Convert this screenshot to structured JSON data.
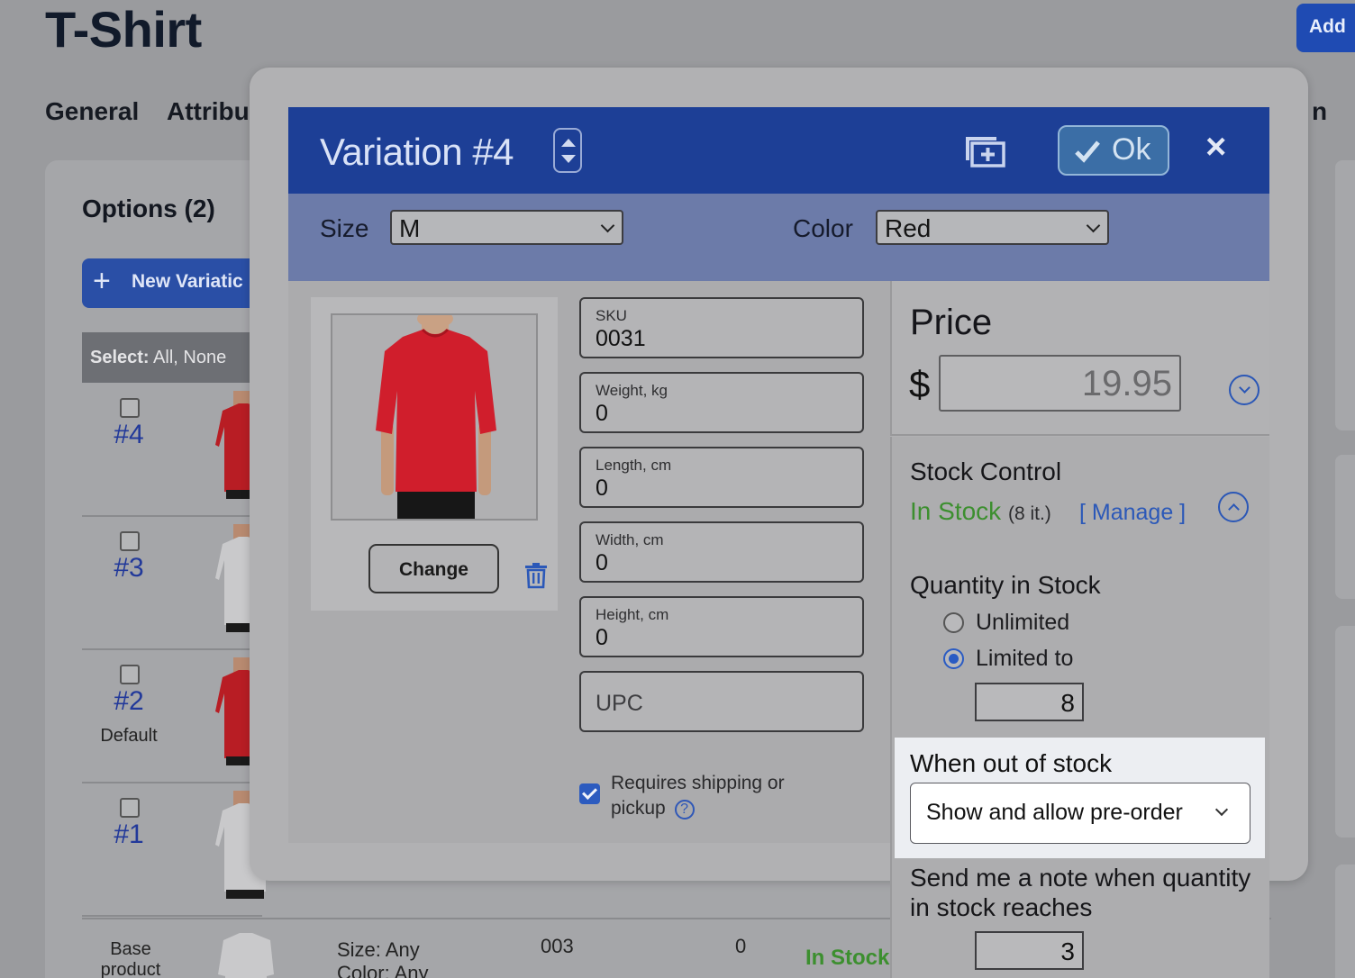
{
  "page": {
    "title": "T-Shirt",
    "add_button": "Add",
    "tabs": [
      "General",
      "Attribu",
      "n"
    ]
  },
  "options": {
    "title": "Options (2)",
    "new_variation": "New Variatic",
    "select_label": "Select:",
    "select_links": "All, None",
    "rows": [
      {
        "num": "#4",
        "sub": "",
        "shirt_color": "#b81d24"
      },
      {
        "num": "#3",
        "sub": "",
        "shirt_color": "#c9c9cb"
      },
      {
        "num": "#2",
        "sub": "Default",
        "shirt_color": "#b81d24"
      },
      {
        "num": "#1",
        "sub": "",
        "shirt_color": "#c9c9cb"
      }
    ],
    "base_row": {
      "label": "Base product",
      "size": "Size: Any",
      "color": "Color: Any",
      "sku": "003",
      "qty": "0",
      "stock": "In Stock"
    }
  },
  "modal": {
    "title": "Variation #4",
    "ok_label": "Ok",
    "close_symbol": "×",
    "attributes": {
      "size_label": "Size",
      "size_value": "M",
      "color_label": "Color",
      "color_value": "Red"
    },
    "image": {
      "change_label": "Change",
      "shirt_color": "#d01e2c"
    },
    "fields": {
      "sku": {
        "label": "SKU",
        "value": "0031"
      },
      "weight": {
        "label": "Weight, kg",
        "value": "0"
      },
      "length": {
        "label": "Length, cm",
        "value": "0"
      },
      "width": {
        "label": "Width, cm",
        "value": "0"
      },
      "height": {
        "label": "Height, cm",
        "value": "0"
      },
      "upc": {
        "placeholder": "UPC"
      }
    },
    "shipping": {
      "checked": true,
      "label": "Requires shipping or pickup",
      "help": "?"
    },
    "price": {
      "title": "Price",
      "currency": "$",
      "value": "19.95"
    },
    "stock": {
      "title": "Stock Control",
      "status": "In Stock",
      "count": "(8 it.)",
      "manage": "[ Manage ]",
      "quantity_title": "Quantity in Stock",
      "unlimited_label": "Unlimited",
      "limited_label": "Limited to",
      "limited_value": "8",
      "selected": "limited",
      "out_of_stock_title": "When out of stock",
      "out_of_stock_value": "Show and allow pre-order",
      "note_text": "Send me a note when quantity in stock reaches",
      "note_value": "3"
    }
  },
  "colors": {
    "header_blue": "#1d3f96",
    "in_stock_green": "#3c8f2f",
    "link_blue": "#2b58b8"
  }
}
